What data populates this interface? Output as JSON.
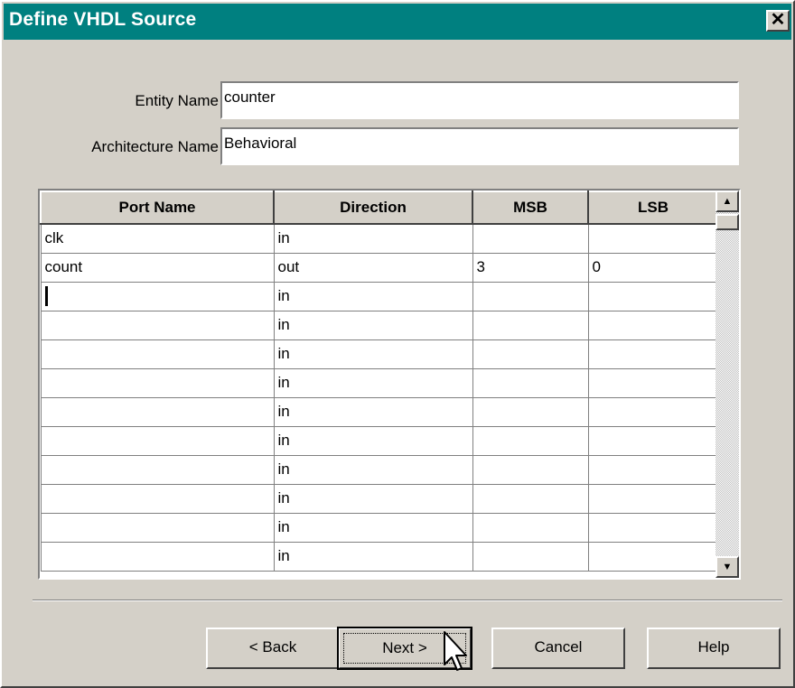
{
  "window": {
    "title": "Define VHDL Source",
    "close_glyph": "✕"
  },
  "form": {
    "entity_label": "Entity Name",
    "entity_value": "counter",
    "architecture_label": "Architecture Name",
    "architecture_value": "Behavioral"
  },
  "ports": {
    "columns": [
      "Port Name",
      "Direction",
      "MSB",
      "LSB"
    ],
    "rows": [
      [
        "clk",
        "in",
        "",
        ""
      ],
      [
        "count",
        "out",
        "3",
        "0"
      ],
      [
        "",
        "in",
        "",
        ""
      ],
      [
        "",
        "in",
        "",
        ""
      ],
      [
        "",
        "in",
        "",
        ""
      ],
      [
        "",
        "in",
        "",
        ""
      ],
      [
        "",
        "in",
        "",
        ""
      ],
      [
        "",
        "in",
        "",
        ""
      ],
      [
        "",
        "in",
        "",
        ""
      ],
      [
        "",
        "in",
        "",
        ""
      ],
      [
        "",
        "in",
        "",
        ""
      ],
      [
        "",
        "in",
        "",
        ""
      ]
    ]
  },
  "buttons": {
    "back": "< Back",
    "next": "Next >",
    "cancel": "Cancel",
    "help": "Help"
  },
  "icons": {
    "close": "close-icon",
    "scroll_up": "scroll-up-arrow-icon",
    "scroll_down": "scroll-down-arrow-icon",
    "cursor": "mouse-pointer-icon"
  }
}
